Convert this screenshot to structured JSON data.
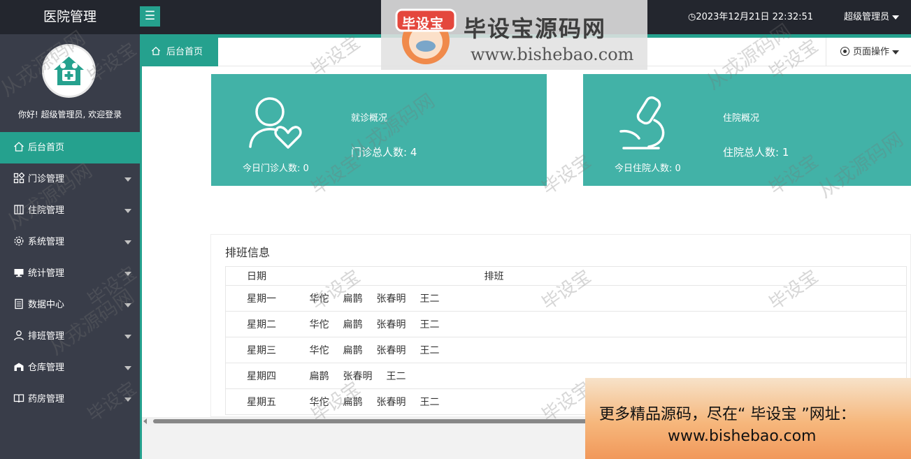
{
  "header": {
    "logo": "医院管理",
    "menu_icon": "hamburger-icon",
    "datetime": "2023年12月21日 22:32:51",
    "user": "超级管理员"
  },
  "sidebar": {
    "welcome": "你好! 超级管理员, 欢迎登录",
    "items": [
      {
        "label": "后台首页",
        "icon": "home-icon",
        "active": true
      },
      {
        "label": "门诊管理",
        "icon": "grid-icon"
      },
      {
        "label": "住院管理",
        "icon": "building-icon"
      },
      {
        "label": "系统管理",
        "icon": "gear-icon"
      },
      {
        "label": "统计管理",
        "icon": "monitor-icon"
      },
      {
        "label": "数据中心",
        "icon": "document-icon"
      },
      {
        "label": "排班管理",
        "icon": "user-icon"
      },
      {
        "label": "仓库管理",
        "icon": "warehouse-icon"
      },
      {
        "label": "药房管理",
        "icon": "book-icon"
      }
    ]
  },
  "tabs": {
    "home": "后台首页",
    "page_ops": "页面操作"
  },
  "cards": {
    "outpatient": {
      "title": "就诊概况",
      "today": "今日门诊人数: 0",
      "total": "门诊总人数: 4"
    },
    "inpatient": {
      "title": "住院概况",
      "today": "今日住院人数: 0",
      "total": "住院总人数: 1"
    }
  },
  "schedule": {
    "title": "排班信息",
    "headers": {
      "date": "日期",
      "staff": "排班"
    },
    "rows": [
      {
        "day": "星期一",
        "staff": [
          "华佗",
          "扁鹊",
          "张春明",
          "王二"
        ]
      },
      {
        "day": "星期二",
        "staff": [
          "华佗",
          "扁鹊",
          "张春明",
          "王二"
        ]
      },
      {
        "day": "星期三",
        "staff": [
          "华佗",
          "扁鹊",
          "张春明",
          "王二"
        ]
      },
      {
        "day": "星期四",
        "staff": [
          "扁鹊",
          "张春明",
          "王二"
        ]
      },
      {
        "day": "星期五",
        "staff": [
          "华佗",
          "扁鹊",
          "张春明",
          "王二"
        ]
      }
    ]
  },
  "watermark": {
    "badge": "毕设宝",
    "name": "毕设宝源码网",
    "url": "www.bishebao.com",
    "banner_line1": "更多精品源码，尽在“ 毕设宝 ”网址：",
    "banner_line2": "www.bishebao.com",
    "overlay_a": "毕设宝",
    "overlay_b": "从戎源码网"
  },
  "colors": {
    "accent": "#25a18e",
    "card": "#42b2a7",
    "sidebar": "#393d49",
    "header": "#23262e"
  }
}
